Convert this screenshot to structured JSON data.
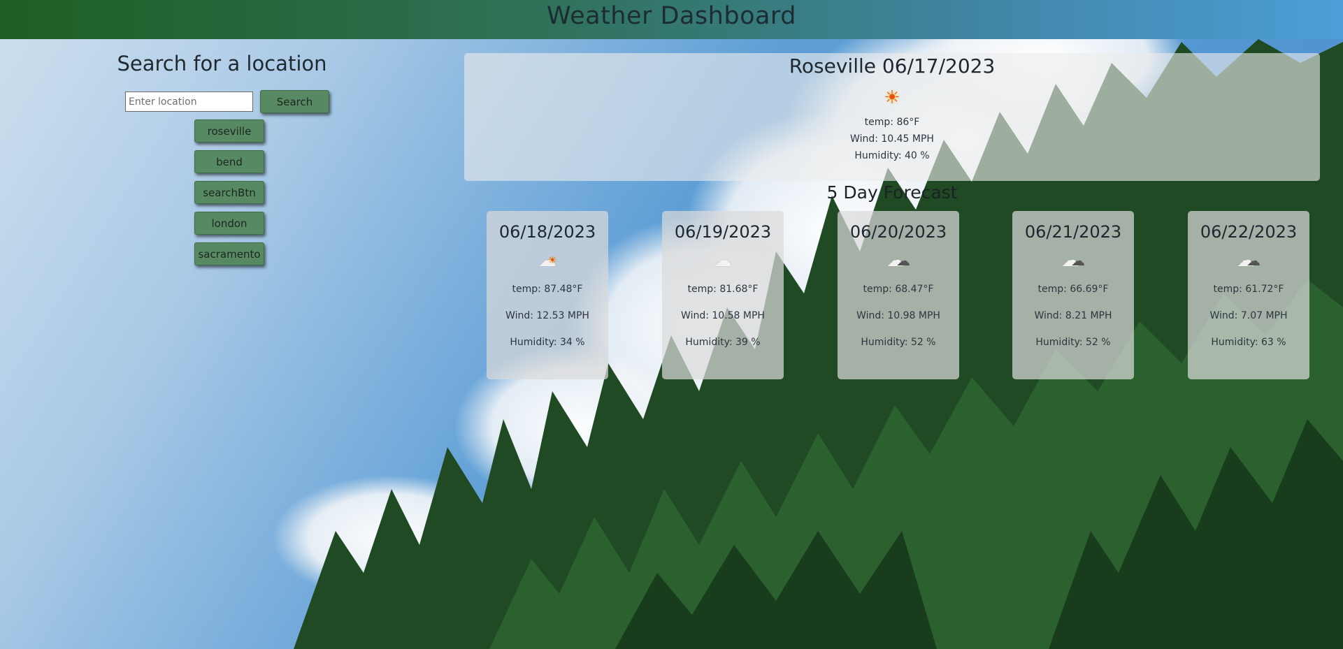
{
  "header": {
    "title": "Weather Dashboard"
  },
  "search": {
    "title": "Search for a location",
    "input_placeholder": "Enter location",
    "input_value": "",
    "button_label": "Search",
    "history": [
      "roseville",
      "bend",
      "searchBtn",
      "london",
      "sacramento"
    ]
  },
  "current": {
    "title": "Roseville 06/17/2023",
    "icon": "sun-icon",
    "temp": "temp: 86°F",
    "wind": "Wind: 10.45 MPH",
    "humidity": "Humidity: 40 %"
  },
  "forecast": {
    "title": "5 Day Forecast",
    "days": [
      {
        "date": "06/18/2023",
        "icon": "sun-behind-cloud-icon",
        "temp": "temp: 87.48°F",
        "wind": "Wind: 12.53 MPH",
        "humidity": "Humidity: 34 %"
      },
      {
        "date": "06/19/2023",
        "icon": "cloud-icon",
        "temp": "temp: 81.68°F",
        "wind": "Wind: 10.58 MPH",
        "humidity": "Humidity: 39 %"
      },
      {
        "date": "06/20/2023",
        "icon": "broken-clouds-icon",
        "temp": "temp: 68.47°F",
        "wind": "Wind: 10.98 MPH",
        "humidity": "Humidity: 52 %"
      },
      {
        "date": "06/21/2023",
        "icon": "broken-clouds-icon",
        "temp": "temp: 66.69°F",
        "wind": "Wind: 8.21 MPH",
        "humidity": "Humidity: 52 %"
      },
      {
        "date": "06/22/2023",
        "icon": "broken-clouds-icon",
        "temp": "temp: 61.72°F",
        "wind": "Wind: 7.07 MPH",
        "humidity": "Humidity: 63 %"
      }
    ]
  },
  "colors": {
    "header_start": "#1d5f22",
    "header_end": "#4d9ed7",
    "button_green": "#578a63",
    "sky": "#7fb0d8",
    "trees": "#1f4a23"
  }
}
